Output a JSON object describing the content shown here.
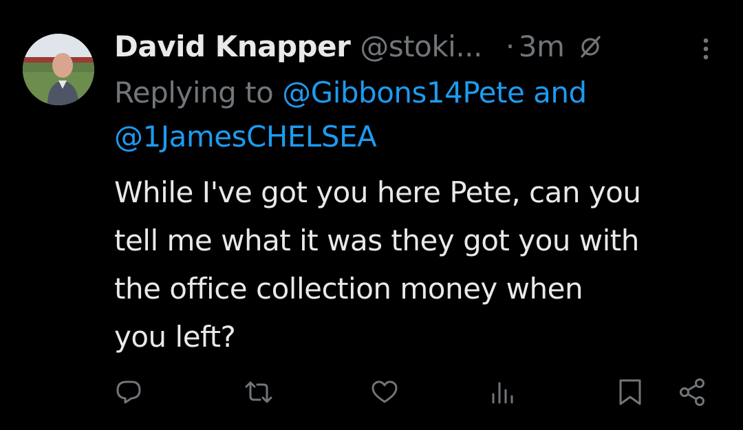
{
  "author": {
    "display_name": "David Knapper",
    "handle": "@stoki...",
    "separator": "·",
    "time": "3m",
    "avatar_icon": "user-avatar-photo"
  },
  "reply": {
    "prefix": "Replying to",
    "mention_1": "@Gibbons14Pete",
    "conjunction": "and",
    "mention_2": "@1JamesCHELSEA"
  },
  "body": {
    "lines": [
      "While I've got you here Pete, can you",
      "tell me what it was they got you with",
      "the office collection money when",
      "you left?"
    ]
  },
  "actions": [
    {
      "name": "reply-icon"
    },
    {
      "name": "retweet-icon"
    },
    {
      "name": "like-icon"
    },
    {
      "name": "views-icon"
    },
    {
      "name": "bookmark-icon"
    },
    {
      "name": "share-icon"
    }
  ],
  "colors": {
    "background": "#000000",
    "text": "#e7e9ea",
    "muted": "#71767b",
    "link": "#1d9bf0"
  }
}
